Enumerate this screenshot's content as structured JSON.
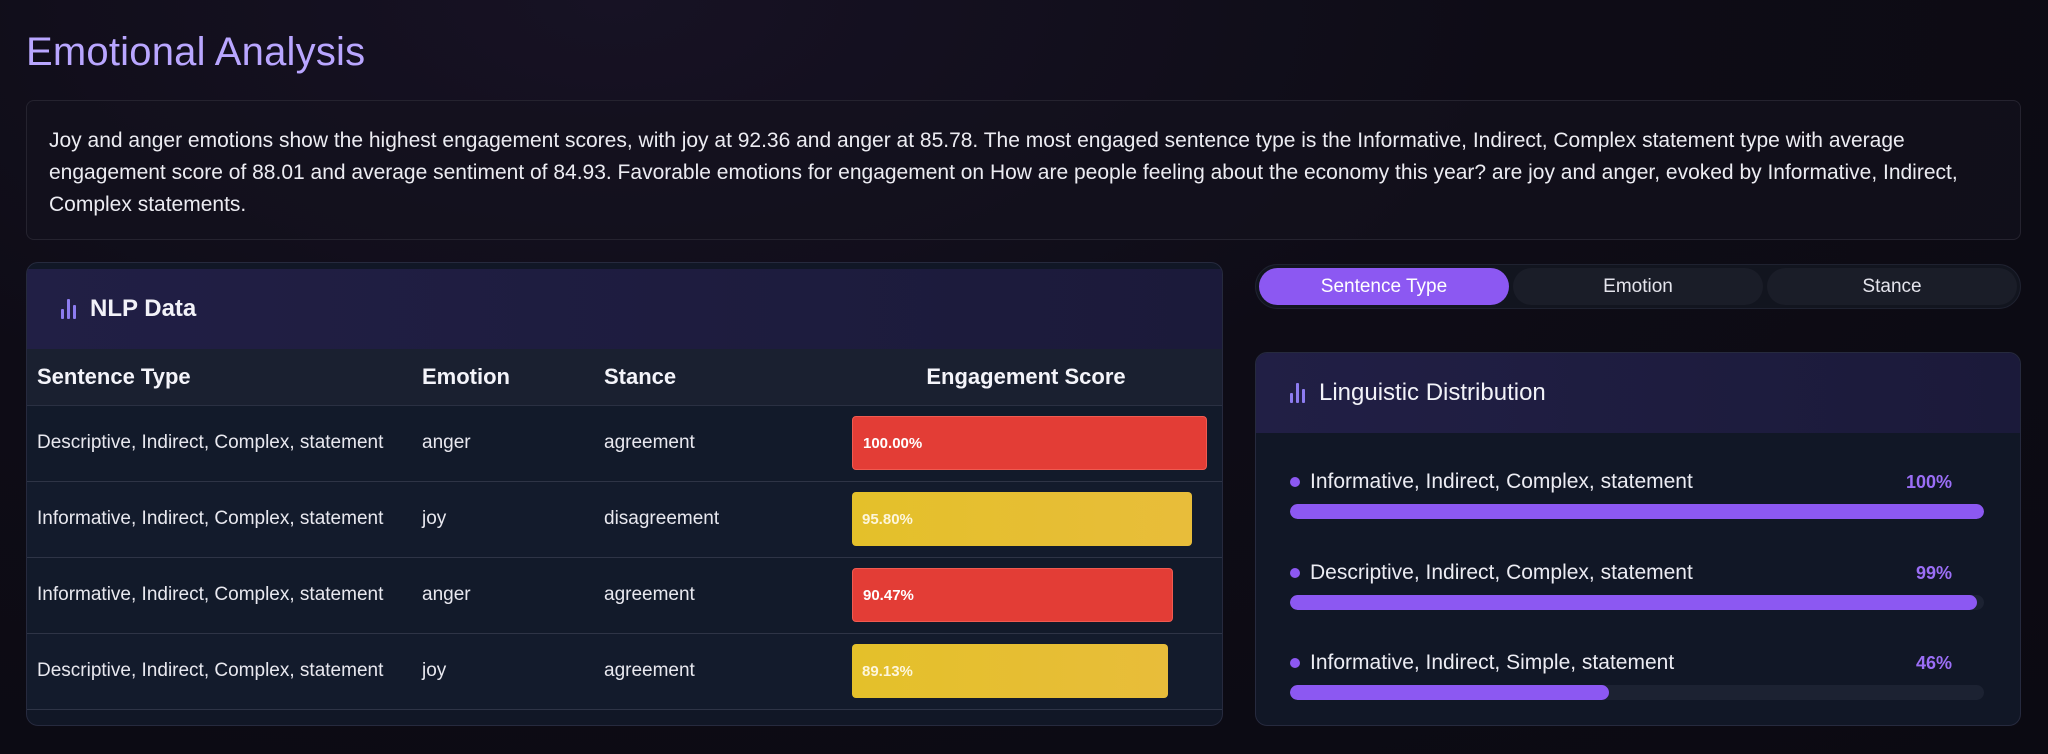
{
  "page": {
    "title": "Emotional Analysis",
    "summary": "Joy and anger emotions show the highest engagement scores, with joy at 92.36 and anger at 85.78. The most engaged sentence type is the Informative, Indirect, Complex statement type with average engagement score of 88.01 and average sentiment of 84.93. Favorable emotions for engagement on How are people feeling about the economy this year? are joy and anger, evoked by Informative, Indirect, Complex statements."
  },
  "nlp": {
    "title": "NLP Data",
    "icon": "bar-chart-icon",
    "columns": [
      "Sentence Type",
      "Emotion",
      "Stance",
      "Engagement Score"
    ],
    "rows": [
      {
        "sentence_type": "Descriptive, Indirect, Complex, statement",
        "emotion": "anger",
        "stance": "agreement",
        "score": "100.00%",
        "score_value": 100.0,
        "color": "red"
      },
      {
        "sentence_type": "Informative, Indirect, Complex, statement",
        "emotion": "joy",
        "stance": "disagreement",
        "score": "95.80%",
        "score_value": 95.8,
        "color": "yellow"
      },
      {
        "sentence_type": "Informative, Indirect, Complex, statement",
        "emotion": "anger",
        "stance": "agreement",
        "score": "90.47%",
        "score_value": 90.47,
        "color": "red"
      },
      {
        "sentence_type": "Descriptive, Indirect, Complex, statement",
        "emotion": "joy",
        "stance": "agreement",
        "score": "89.13%",
        "score_value": 89.13,
        "color": "yellow"
      }
    ]
  },
  "tabs": [
    {
      "label": "Sentence Type",
      "active": true
    },
    {
      "label": "Emotion",
      "active": false
    },
    {
      "label": "Stance",
      "active": false
    }
  ],
  "linguistic": {
    "title": "Linguistic Distribution",
    "icon": "bar-chart-icon",
    "items": [
      {
        "label": "Informative, Indirect, Complex, statement",
        "pct": "100%",
        "value": 100
      },
      {
        "label": "Descriptive, Indirect, Complex, statement",
        "pct": "99%",
        "value": 99
      },
      {
        "label": "Informative, Indirect, Simple, statement",
        "pct": "46%",
        "value": 46
      }
    ]
  },
  "colors": {
    "accent": "#8c58f2",
    "title": "#b9a6ff",
    "red": "#e33d36",
    "yellow": "#e4c02a"
  }
}
